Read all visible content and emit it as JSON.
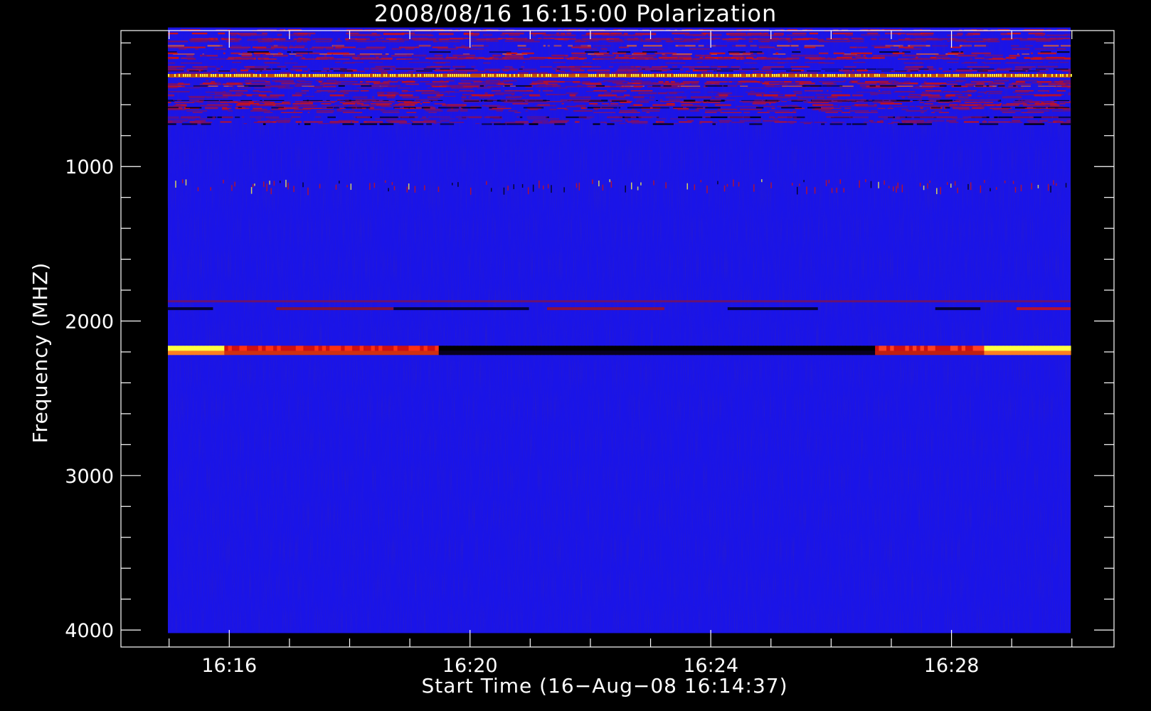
{
  "chart_data": {
    "type": "heatmap",
    "title": "2008/08/16 16:15:00 Polarization",
    "xlabel": "Start Time (16−Aug−08 16:14:37)",
    "ylabel": "Frequency (MHZ)",
    "x_ticks": [
      {
        "label": "16:16",
        "minutes": 16
      },
      {
        "label": "16:20",
        "minutes": 20
      },
      {
        "label": "16:24",
        "minutes": 24
      },
      {
        "label": "16:28",
        "minutes": 28
      }
    ],
    "y_ticks": [
      {
        "label": "1000",
        "value": 1000
      },
      {
        "label": "2000",
        "value": 2000
      },
      {
        "label": "3000",
        "value": 3000
      },
      {
        "label": "4000",
        "value": 4000
      }
    ],
    "xlim_minutes": [
      14.2,
      30.7
    ],
    "ylim_mhz": [
      120,
      4110
    ],
    "data_x_range_minutes": [
      14.98,
      29.98
    ],
    "data_y_range_mhz": [
      100,
      4020
    ],
    "y_inverted": true,
    "colors": {
      "background": "#000000",
      "axes": "#ffffff",
      "base": "#1a14e8",
      "red": "#d01010",
      "yellow": "#ffff40",
      "black": "#000000"
    },
    "features": [
      {
        "kind": "noisy-band",
        "freq_mhz": [
          100,
          720
        ],
        "description": "strong RFI with red/yellow lines"
      },
      {
        "kind": "line",
        "freq_mhz": 410,
        "intensity": "yellow"
      },
      {
        "kind": "dashed-line",
        "freq_mhz": [
          1080,
          1140
        ],
        "intensity": "red"
      },
      {
        "kind": "line",
        "freq_mhz": 1870,
        "intensity": "red"
      },
      {
        "kind": "line",
        "freq_mhz": 1920,
        "intensity": "dark"
      },
      {
        "kind": "strong-line",
        "freq_mhz": [
          2160,
          2220
        ],
        "left": "yellow",
        "middle": "black",
        "right": "yellow"
      }
    ]
  }
}
